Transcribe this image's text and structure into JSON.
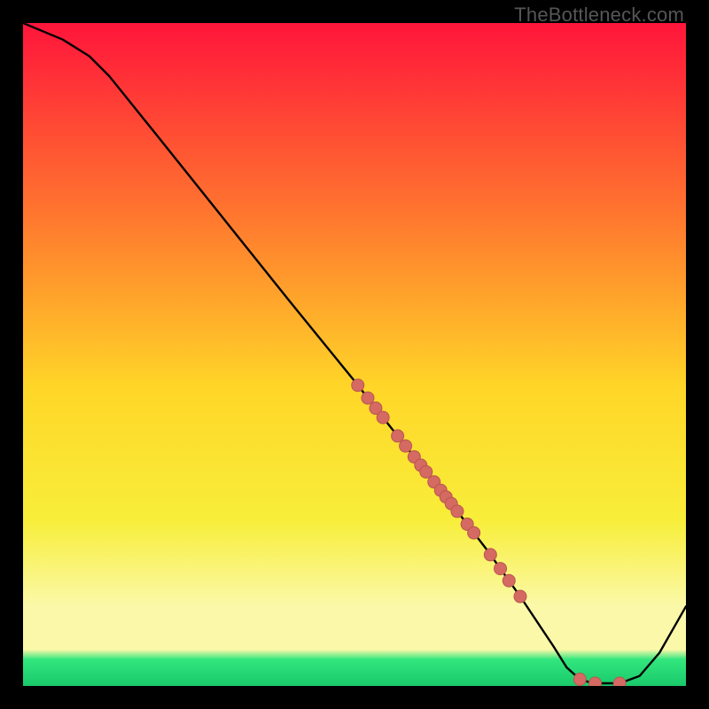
{
  "watermark": "TheBottleneck.com",
  "colors": {
    "gradient_top": "#ff153b",
    "gradient_upper_mid": "#ff7a2e",
    "gradient_mid": "#ffd628",
    "gradient_lower_mid": "#f8ee3a",
    "gradient_pale": "#fbf9a9",
    "gradient_green": "#32e67d",
    "gradient_green_deep": "#19c96b",
    "curve": "#000000",
    "dot_fill": "#d46a62",
    "dot_stroke": "#b9564f"
  },
  "chart_data": {
    "type": "line",
    "title": "",
    "xlabel": "",
    "ylabel": "",
    "xlim": [
      0,
      100
    ],
    "ylim": [
      0,
      100
    ],
    "curve": [
      {
        "x": 0,
        "y": 100
      },
      {
        "x": 6,
        "y": 97.5
      },
      {
        "x": 10,
        "y": 95
      },
      {
        "x": 13,
        "y": 92
      },
      {
        "x": 20,
        "y": 83.3
      },
      {
        "x": 30,
        "y": 70.8
      },
      {
        "x": 40,
        "y": 58.3
      },
      {
        "x": 50,
        "y": 46
      },
      {
        "x": 55,
        "y": 39.6
      },
      {
        "x": 60,
        "y": 33.3
      },
      {
        "x": 65,
        "y": 27
      },
      {
        "x": 70,
        "y": 20.5
      },
      {
        "x": 75,
        "y": 13.5
      },
      {
        "x": 78,
        "y": 9
      },
      {
        "x": 80,
        "y": 6
      },
      {
        "x": 82,
        "y": 2.8
      },
      {
        "x": 84,
        "y": 1
      },
      {
        "x": 86,
        "y": 0.4
      },
      {
        "x": 90,
        "y": 0.4
      },
      {
        "x": 93,
        "y": 1.5
      },
      {
        "x": 96,
        "y": 5
      },
      {
        "x": 100,
        "y": 12
      }
    ],
    "dots_on_curve_x": [
      50.5,
      52,
      53.2,
      54.3,
      56.5,
      57.7,
      59,
      60,
      60.8,
      62,
      63,
      63.8,
      64.6,
      65.5,
      67,
      68,
      70.5,
      72,
      73.3,
      75,
      84,
      86.3,
      90
    ],
    "dot_radius": 7
  }
}
